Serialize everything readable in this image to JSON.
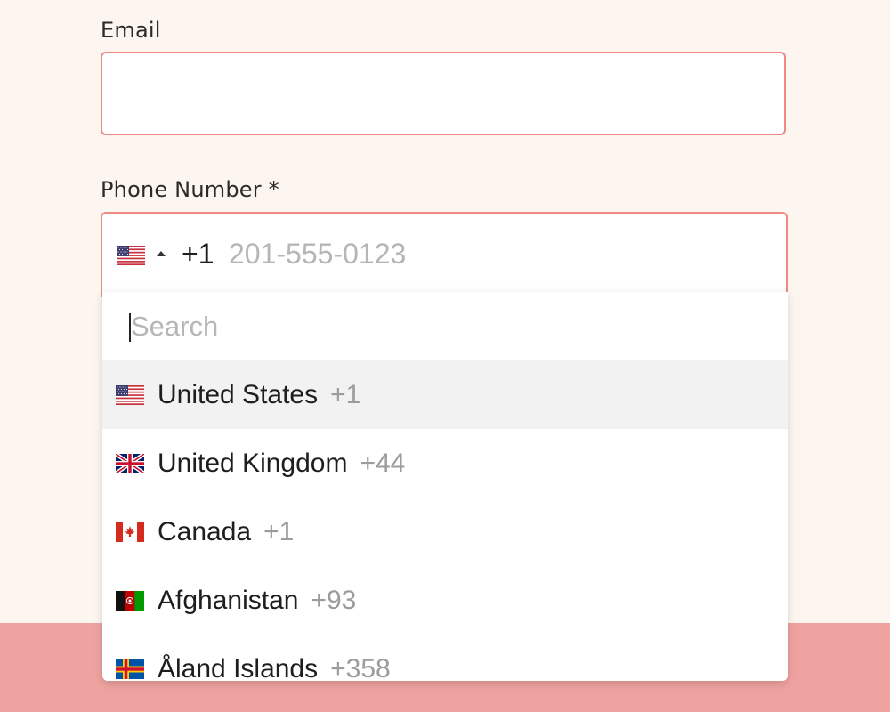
{
  "form": {
    "email_label": "Email",
    "email_value": "",
    "phone_label": "Phone Number *",
    "phone": {
      "selected_flag": "us-flag-icon",
      "dial_code": "+1",
      "placeholder": "201-555-0123"
    }
  },
  "dropdown": {
    "search_placeholder": "Search",
    "countries": [
      {
        "name": "United States",
        "code": "+1",
        "flag": "us-flag-icon",
        "selected": true
      },
      {
        "name": "United Kingdom",
        "code": "+44",
        "flag": "uk-flag-icon",
        "selected": false
      },
      {
        "name": "Canada",
        "code": "+1",
        "flag": "canada-flag-icon",
        "selected": false
      },
      {
        "name": "Afghanistan",
        "code": "+93",
        "flag": "afghanistan-flag-icon",
        "selected": false
      },
      {
        "name": "Åland Islands",
        "code": "+358",
        "flag": "aland-flag-icon",
        "selected": false
      }
    ]
  },
  "colors": {
    "page_background": "#fdf6f0",
    "input_border": "#ee8a83",
    "bottom_band": "#efa3a0",
    "highlight_row": "#f2f2f2"
  }
}
